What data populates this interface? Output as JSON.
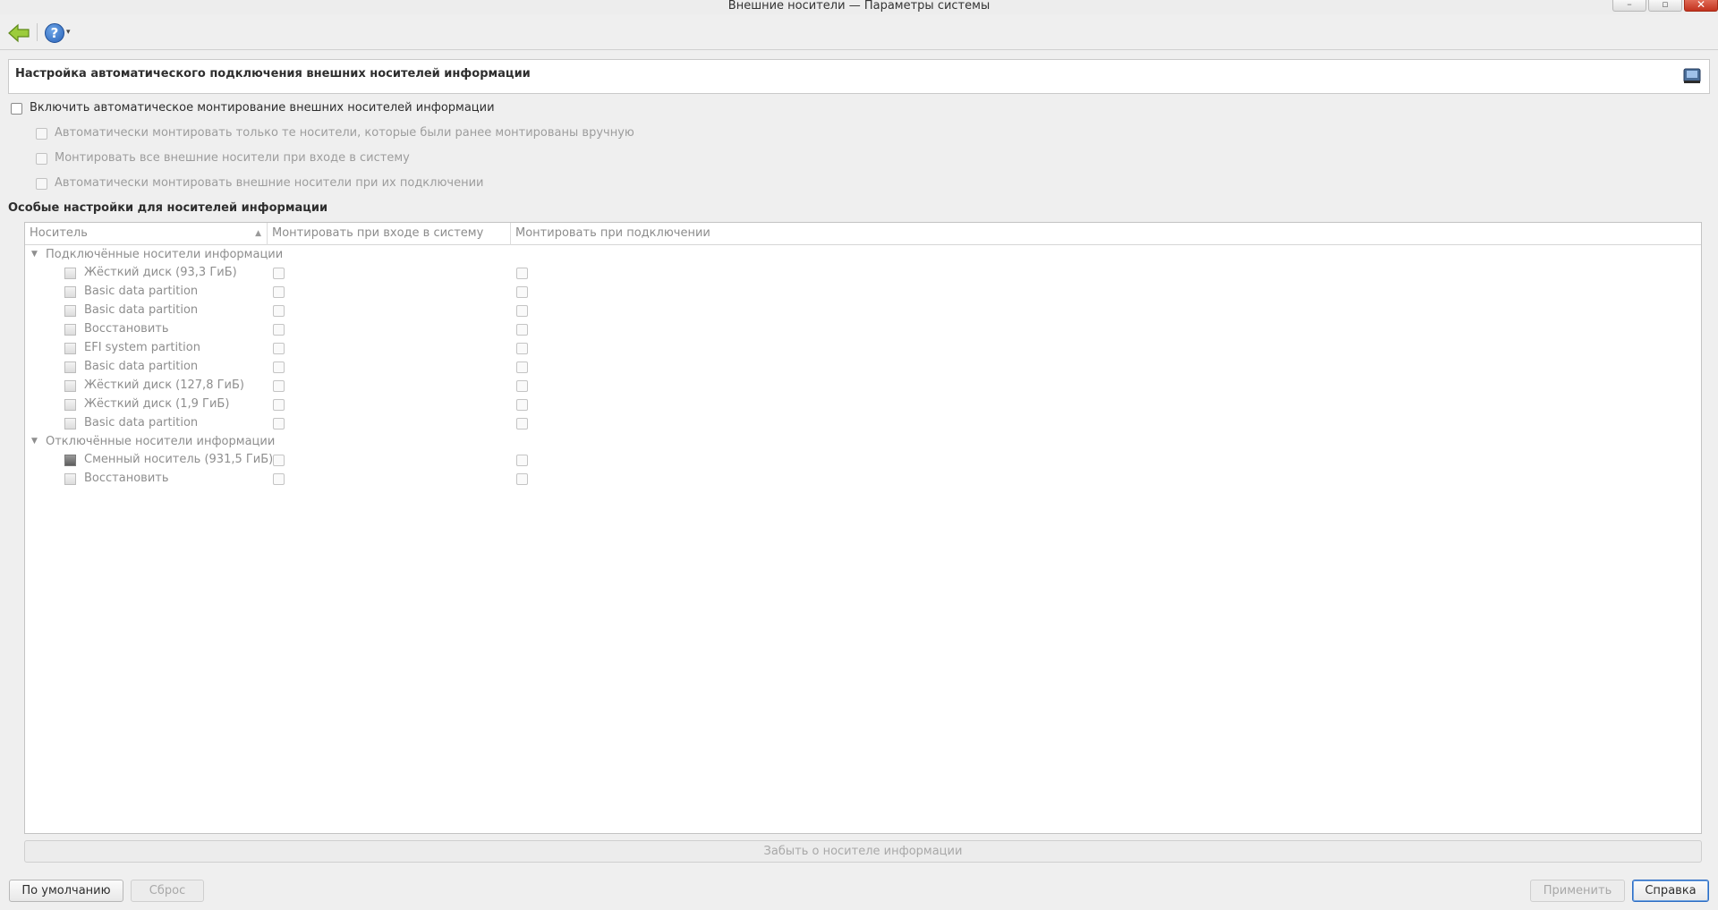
{
  "window": {
    "title": "Внешние носители — Параметры системы",
    "buttons": {
      "minimize": "–",
      "maximize": "▫",
      "close": "✕"
    }
  },
  "toolbar": {
    "back_icon": "back-arrow-icon",
    "help_icon": "help-icon",
    "help_symbol": "?",
    "help_dropdown": "▾"
  },
  "header": {
    "title": "Настройка автоматического подключения внешних носителей информации",
    "icon": "removable-drive-icon"
  },
  "options": {
    "enable_automount": {
      "label": "Включить автоматическое монтирование внешних носителей информации",
      "checked": false,
      "enabled": true
    },
    "only_previously_mounted": {
      "label": "Автоматически монтировать только те носители, которые были ранее монтированы вручную",
      "checked": false,
      "enabled": false
    },
    "mount_on_login": {
      "label": "Монтировать все внешние носители при входе в систему",
      "checked": false,
      "enabled": false
    },
    "mount_on_attach": {
      "label": "Автоматически монтировать внешние носители при их подключении",
      "checked": false,
      "enabled": false
    }
  },
  "device_section": {
    "title": "Особые настройки для носителей информации",
    "columns": {
      "device": "Носитель",
      "sort_indicator": "▲",
      "mount_on_login": "Монтировать при входе в систему",
      "mount_on_attach": "Монтировать при подключении"
    },
    "groups": [
      {
        "label": "Подключённые носители информации",
        "expanded_symbol": "▼",
        "devices": [
          "Жёсткий диск (93,3 ГиБ)",
          "Basic data partition",
          "Basic data partition",
          "Восстановить",
          "EFI system partition",
          "Basic data partition",
          "Жёсткий диск (127,8 ГиБ)",
          "Жёсткий диск (1,9 ГиБ)",
          "Basic data partition"
        ]
      },
      {
        "label": "Отключённые носители информации",
        "expanded_symbol": "▼",
        "devices": [
          "Сменный носитель (931,5 ГиБ)",
          "Восстановить"
        ]
      }
    ],
    "forget_button": "Забыть о носителе информации"
  },
  "footer": {
    "defaults": "По умолчанию",
    "reset": "Сброс",
    "apply": "Применить",
    "help": "Справка"
  }
}
